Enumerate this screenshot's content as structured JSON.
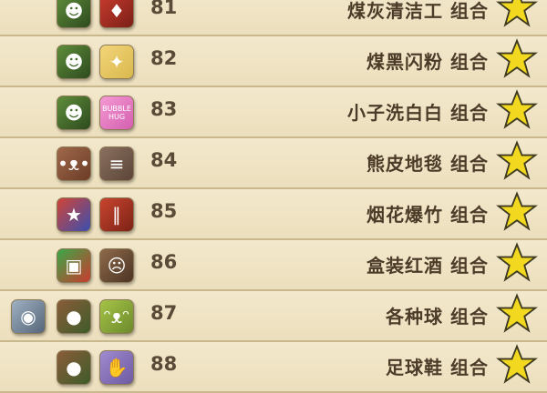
{
  "colors": {
    "row_bg": "#efe3c3",
    "text": "#4b3b28",
    "star": "#f2d81e"
  },
  "rows": [
    {
      "number": "81",
      "name": "煤灰清洁工",
      "suffix": "组合",
      "icons": [
        "character-icon",
        "stocking-icon"
      ]
    },
    {
      "number": "82",
      "name": "煤黑闪粉",
      "suffix": "组合",
      "icons": [
        "character-icon",
        "dust-icon"
      ]
    },
    {
      "number": "83",
      "name": "小子洗白白",
      "suffix": "组合",
      "icons": [
        "character-icon",
        "bubble-hug-icon"
      ],
      "icon_text": "BUBBLE HUG"
    },
    {
      "number": "84",
      "name": "熊皮地毯",
      "suffix": "组合",
      "icons": [
        "bear-icon",
        "rug-icon"
      ]
    },
    {
      "number": "85",
      "name": "烟花爆竹",
      "suffix": "组合",
      "icons": [
        "hat-icon",
        "firecracker-icon"
      ]
    },
    {
      "number": "86",
      "name": "盒装红酒",
      "suffix": "组合",
      "icons": [
        "gift-box-icon",
        "zombie-icon"
      ]
    },
    {
      "number": "87",
      "name": "各种球",
      "suffix": "组合",
      "icons": [
        "robot-icon",
        "ball-icon",
        "green-creature-icon"
      ]
    },
    {
      "number": "88",
      "name": "足球鞋",
      "suffix": "组合",
      "icons": [
        "ball-icon",
        "foot-icon"
      ]
    }
  ]
}
